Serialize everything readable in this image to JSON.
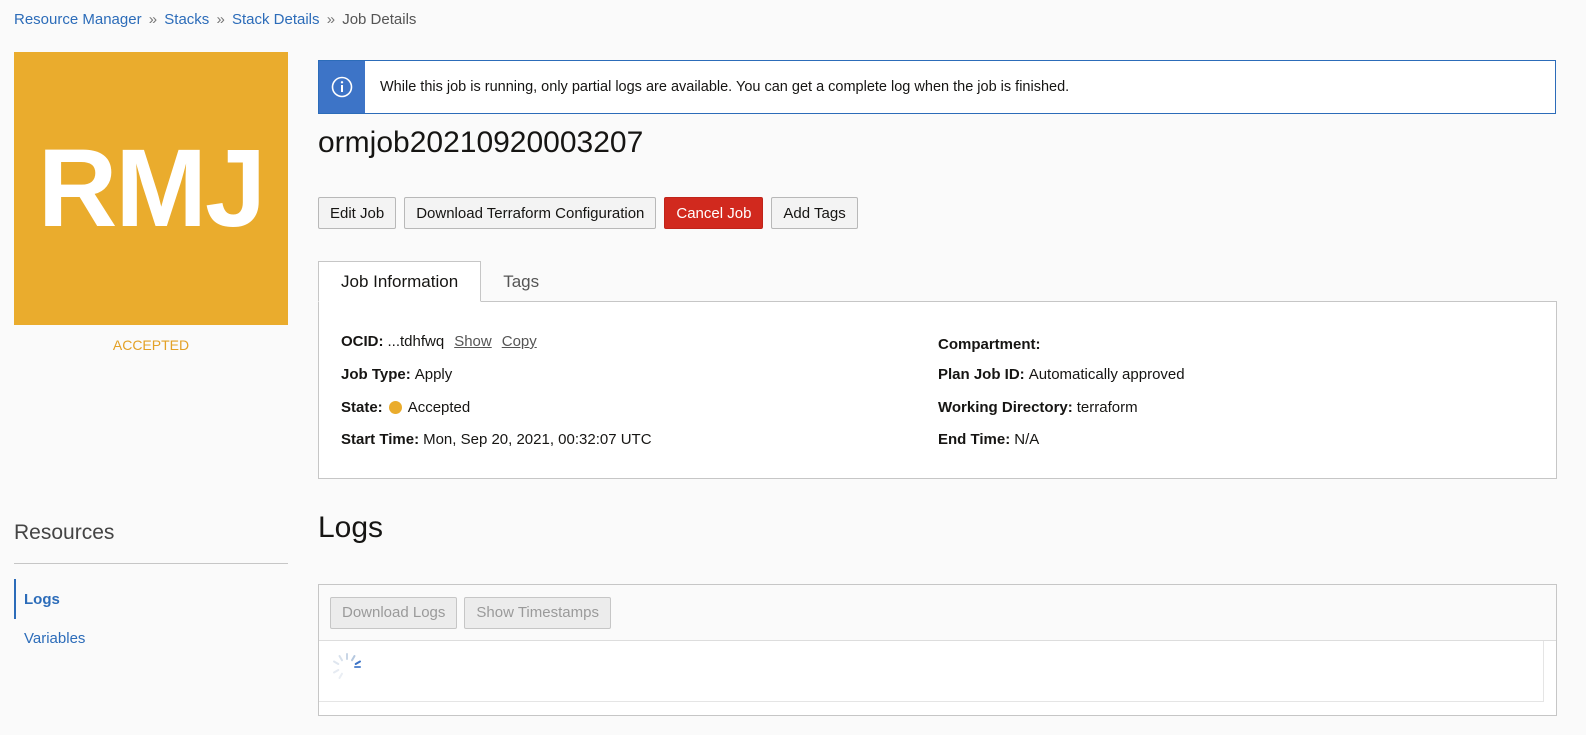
{
  "breadcrumb": {
    "items": [
      "Resource Manager",
      "Stacks",
      "Stack Details"
    ],
    "separator": "»",
    "current": "Job Details"
  },
  "badge": {
    "initials": "RMJ",
    "color": "#eaac2d",
    "state_label": "ACCEPTED"
  },
  "banner": {
    "icon": "info-icon",
    "message": "While this job is running, only partial logs are available. You can get a complete log when the job is finished."
  },
  "job": {
    "title": "ormjob20210920003207"
  },
  "actions": {
    "edit": "Edit Job",
    "download_config": "Download Terraform Configuration",
    "cancel": "Cancel Job",
    "add_tags": "Add Tags"
  },
  "tabs": {
    "info": "Job Information",
    "tags": "Tags"
  },
  "job_info": {
    "ocid_label": "OCID:",
    "ocid_value": "...tdhfwq",
    "show": "Show",
    "copy": "Copy",
    "job_type_label": "Job Type:",
    "job_type_value": "Apply",
    "state_label": "State:",
    "state_value": "Accepted",
    "start_time_label": "Start Time:",
    "start_time_value": "Mon, Sep 20, 2021, 00:32:07 UTC",
    "compartment_label": "Compartment:",
    "plan_job_label": "Plan Job ID:",
    "plan_job_value": "Automatically approved",
    "working_dir_label": "Working Directory:",
    "working_dir_value": "terraform",
    "end_time_label": "End Time:",
    "end_time_value": "N/A"
  },
  "resources": {
    "title": "Resources",
    "items": [
      "Logs",
      "Variables"
    ]
  },
  "logs": {
    "title": "Logs",
    "download": "Download Logs",
    "show_timestamps": "Show Timestamps"
  }
}
